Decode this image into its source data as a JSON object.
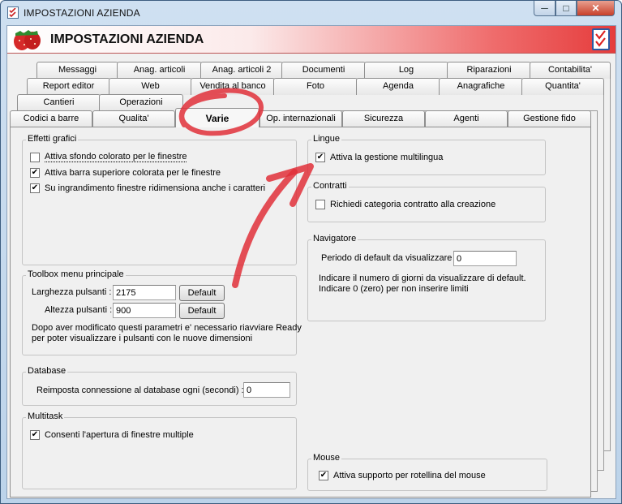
{
  "window": {
    "title": "IMPOSTAZIONI AZIENDA",
    "minimize": "─",
    "maximize": "□",
    "close": "✕"
  },
  "header": {
    "title": "IMPOSTAZIONI AZIENDA"
  },
  "tabs": {
    "row1": [
      "Messaggi",
      "Anag. articoli",
      "Anag. articoli 2",
      "Documenti",
      "Log",
      "Riparazioni",
      "Contabilita'"
    ],
    "row2": [
      "Report editor",
      "Web",
      "Vendita al banco",
      "Foto",
      "Agenda",
      "Anagrafiche",
      "Quantita'"
    ],
    "row3": [
      "Cantieri",
      "Operazioni"
    ],
    "row4": [
      "Codici a barre",
      "Qualita'",
      "Varie",
      "Op. internazionali",
      "Sicurezza",
      "Agenti",
      "Gestione fido"
    ]
  },
  "effetti": {
    "title": "Effetti grafici",
    "items": [
      {
        "label": "Attiva sfondo colorato per le finestre",
        "checked": false
      },
      {
        "label": "Attiva barra superiore colorata per le finestre",
        "checked": true
      },
      {
        "label": "Su ingrandimento finestre ridimensiona anche i caratteri",
        "checked": true
      }
    ]
  },
  "toolbox": {
    "title": "Toolbox menu principale",
    "width_label": "Larghezza pulsanti :",
    "width_value": "2175",
    "height_label": "Altezza pulsanti :",
    "height_value": "900",
    "default_label": "Default",
    "note1": "Dopo aver modificato questi parametri e' necessario riavviare Ready",
    "note2": "per poter visualizzare i pulsanti con le nuove dimensioni"
  },
  "database": {
    "title": "Database",
    "label": "Reimposta connessione al database ogni (secondi) :",
    "value": "0"
  },
  "multitask": {
    "title": "Multitask",
    "label": "Consenti l'apertura di finestre multiple",
    "checked": true
  },
  "lingue": {
    "title": "Lingue",
    "label": "Attiva la gestione multilingua",
    "checked": true
  },
  "contratti": {
    "title": "Contratti",
    "label": "Richiedi categoria contratto alla creazione",
    "checked": false
  },
  "navigatore": {
    "title": "Navigatore",
    "label": "Periodo di default da visualizzare :",
    "value": "0",
    "note1": "Indicare il numero di giorni da visualizzare di default.",
    "note2": "Indicare 0 (zero) per non inserire limiti"
  },
  "mouse": {
    "title": "Mouse",
    "label": "Attiva supporto per rotellina del mouse",
    "checked": true
  },
  "colors": {
    "accent_red": "#e53c3c",
    "annotation": "#e0303a"
  }
}
